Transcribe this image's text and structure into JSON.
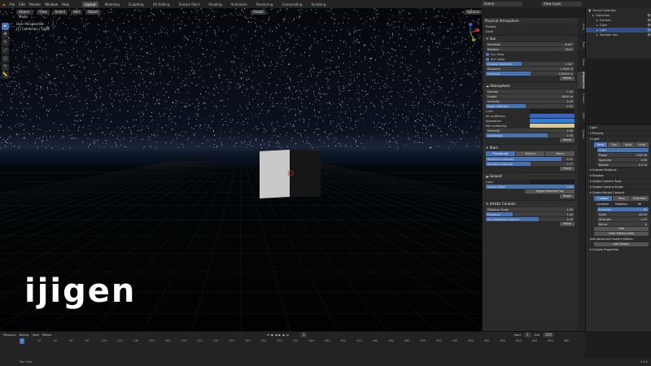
{
  "menu": [
    "File",
    "Edit",
    "Render",
    "Window",
    "Help"
  ],
  "workspaces": [
    "Layout",
    "Modeling",
    "Sculpting",
    "UV Editing",
    "Texture Paint",
    "Shading",
    "Animation",
    "Rendering",
    "Compositing",
    "Scripting"
  ],
  "active_workspace": "Layout",
  "scene": {
    "name": "Scene",
    "view_layer": "View Layer"
  },
  "viewport": {
    "header": [
      "Object Mode",
      "View",
      "Select",
      "Add",
      "Object",
      "Global"
    ],
    "overlay_line1": "User Perspective",
    "overlay_line2": "(1) Collection | Light",
    "options": "Options",
    "tools": [
      "cursor",
      "move",
      "rotate",
      "scale",
      "transform",
      "annotate",
      "measure"
    ]
  },
  "logo": "ijigen",
  "npanel": {
    "title": "Physical Atmosphere",
    "preset_label": "Presets",
    "preset_value": "Earth",
    "sun": {
      "title": "Sun",
      "rows": [
        [
          "Elevation",
          "-8.00°"
        ],
        [
          "Rotation",
          "29.8°"
        ]
      ],
      "checks": [
        "Sun Glow",
        "Sun Lamp"
      ],
      "rows2": [
        [
          "Angular Diameter",
          "0.54°"
        ],
        [
          "Radiance",
          "1.0000 K"
        ],
        [
          "Intensity",
          "100000 lx"
        ]
      ],
      "fills": [
        0,
        0,
        0.4,
        0,
        0.5
      ]
    },
    "atmosphere": {
      "title": "Atmosphere",
      "rows": [
        [
          "Density",
          "1.00"
        ],
        [
          "Height",
          "8000 m"
        ],
        [
          "Intensity",
          "1.00"
        ],
        [
          "Night Intensity",
          "0.02"
        ]
      ],
      "fills": [
        0,
        0,
        0,
        0.45
      ],
      "colors": [
        [
          "Color",
          "#1e1e1e"
        ],
        [
          "Air scattering",
          "#3a63c8"
        ],
        [
          "Absorption",
          "#2a7fe0"
        ],
        [
          "Mie Scattering",
          "#d8c89a"
        ]
      ],
      "rows2": [
        [
          "Intensity",
          "1.00"
        ],
        [
          "Anisotropy",
          "0.76"
        ]
      ],
      "fills2": [
        0,
        0.7
      ]
    },
    "stars": {
      "title": "Stars",
      "modes": [
        "Procedural",
        "Texture",
        "None"
      ],
      "active_mode": "Procedural",
      "rows": [
        [
          "Radiance Intensity",
          "0.01"
        ],
        [
          "Radiance Gamma",
          "0.77"
        ]
      ],
      "fills": [
        0.85,
        0.5
      ]
    },
    "ground": {
      "title": "Ground",
      "color_label": "Color",
      "row": [
        "Visual Offset",
        "0.00"
      ],
      "button": "Toggle Material Fog"
    },
    "artistic": {
      "title": "Artistic Controls",
      "rows": [
        [
          "Distance Scale",
          "1.00"
        ],
        [
          "Exposure",
          "1.00"
        ],
        [
          "Sun Radiance Gamma",
          "1.00"
        ]
      ],
      "fills": [
        0,
        0.3,
        0.6
      ]
    },
    "reset": "Reset"
  },
  "ntabs": [
    "Item",
    "Tool",
    "View",
    "Atmosphere",
    "Create",
    "Edit",
    "Quake"
  ],
  "outliner": {
    "title": "Scene Collection",
    "items": [
      [
        "Collection",
        1,
        false
      ],
      [
        "Camera",
        2,
        false
      ],
      [
        "Cube",
        2,
        false
      ],
      [
        "Light",
        2,
        true
      ],
      [
        "Starlight Sun",
        2,
        false
      ]
    ]
  },
  "properties": {
    "object": "Light",
    "sections": [
      "Preview",
      "Light"
    ],
    "light_types": [
      "Point",
      "Sun",
      "Spot",
      "Area"
    ],
    "active_light": "Point",
    "rows": [
      [
        "Color",
        ""
      ],
      [
        "Power",
        "1000 W"
      ],
      [
        "Specular",
        "1.00"
      ],
      [
        "Radius",
        "0.1 m"
      ]
    ],
    "custom_distance": "Custom Distance",
    "shadow": "Shadow",
    "quake_sections": [
      "Quake Camera Tools",
      "Quake Camera Shake",
      "Quake Motion Camera"
    ],
    "motion_modes": [
      "Custom",
      "Hero",
      "Dramatic"
    ],
    "active_motion": "Custom",
    "check_labels": [
      "Location",
      "Rotation",
      "All"
    ],
    "duration_label": "Duration",
    "duration_value": "60",
    "scale_label": "Scale",
    "scale_value": "40.00",
    "strength_label": "Strength",
    "strength_value": "1.00",
    "blend_label": "Blend",
    "blend_value": "0",
    "add_btn": "Add",
    "clear_btn": "Clear Motion Data",
    "advanced": "Add advanced Camera Motion",
    "add_motion": "Add Motion",
    "custom_props": "Custom Properties"
  },
  "timeline": {
    "menus": [
      "Playback",
      "Keying",
      "View",
      "Marker"
    ],
    "start_label": "Start",
    "start": "1",
    "end_label": "End",
    "end": "250",
    "current": "1",
    "ticks": [
      "20",
      "40",
      "60",
      "80",
      "100",
      "120",
      "140",
      "160",
      "180",
      "200",
      "220",
      "240",
      "260",
      "280",
      "300",
      "320",
      "340",
      "360",
      "380",
      "400",
      "420",
      "440",
      "460",
      "480",
      "500",
      "520",
      "540",
      "560",
      "580",
      "600",
      "620",
      "640",
      "660",
      "680"
    ]
  },
  "status": {
    "left": "Pan View",
    "right": "3.6.0"
  }
}
